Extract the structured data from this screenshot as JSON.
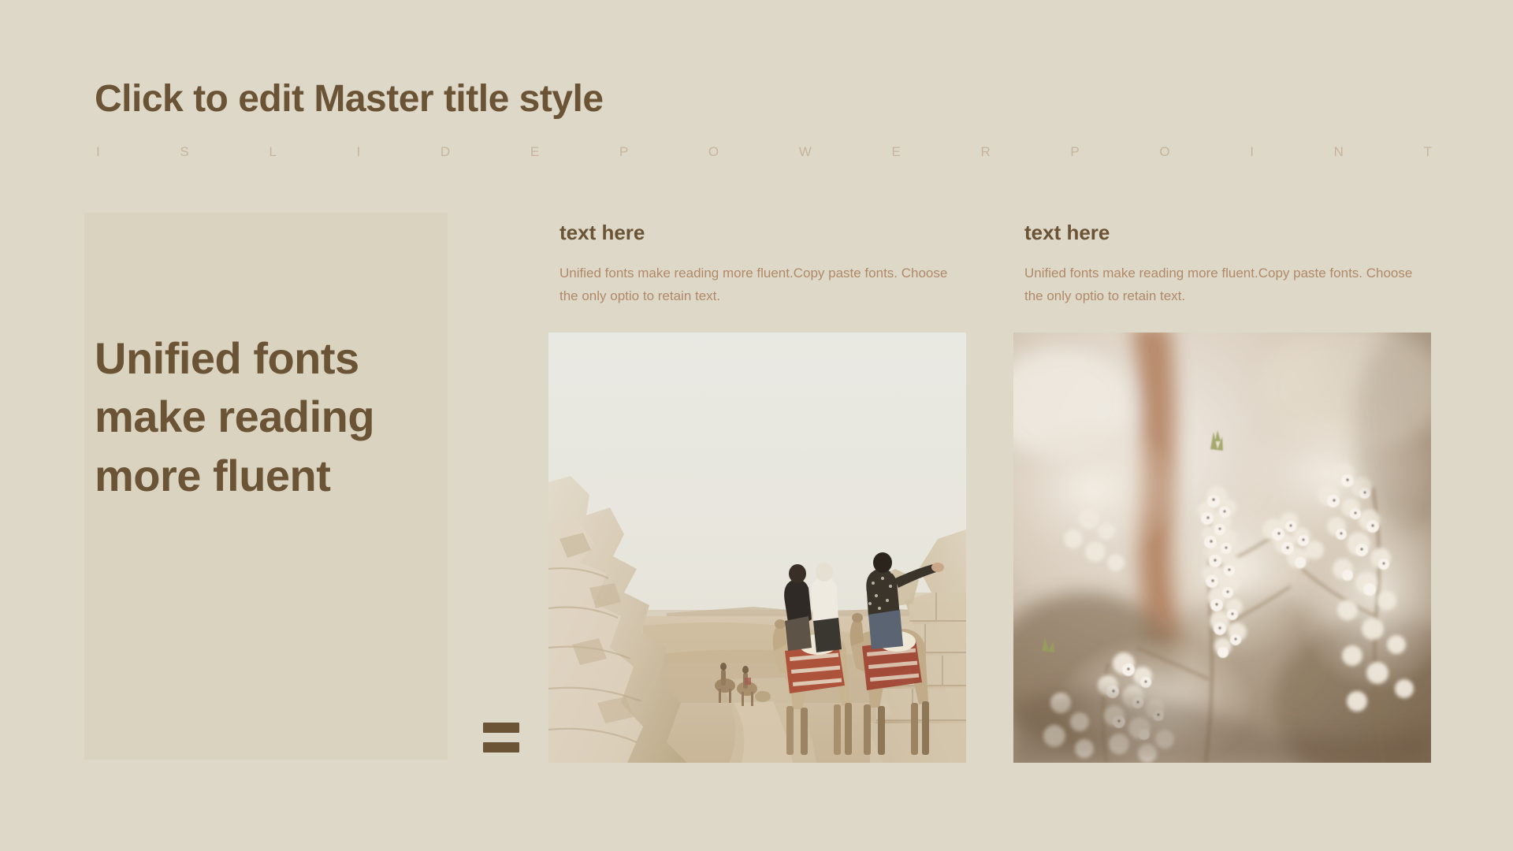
{
  "slide": {
    "background_color": "#ded8c8",
    "panel_color": "#dad3c0",
    "heading_color": "#6b5335",
    "body_color": "#b08968",
    "brand_color": "#c8b49c"
  },
  "header": {
    "master_title": "Click to edit Master title style",
    "brand_letters": [
      "I",
      "S",
      "L",
      "I",
      "D",
      "E",
      "P",
      "O",
      "W",
      "E",
      "R",
      "P",
      "O",
      "I",
      "N",
      "T"
    ],
    "brand_text": "ISLIDE POWERPOINT"
  },
  "quote": {
    "text": "Unified fonts make reading more fluent"
  },
  "equals": {
    "symbol": "="
  },
  "columns": [
    {
      "heading": "text here",
      "body": "Unified fonts make reading more fluent.Copy paste fonts. Choose the only optio to retain text.",
      "image_alt": "desert-camel-riders-photo"
    },
    {
      "heading": "text here",
      "body": "Unified fonts make reading more fluent.Copy paste fonts. Choose the only optio to retain text.",
      "image_alt": "white-blossom-branches-photo"
    }
  ]
}
